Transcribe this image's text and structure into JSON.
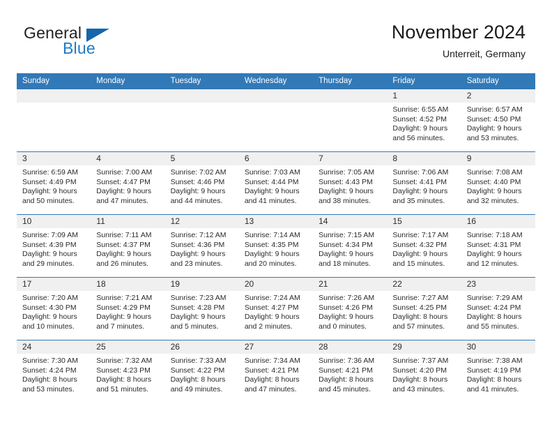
{
  "brand": {
    "word1": "General",
    "word2": "Blue",
    "triangle_color": "#1566ad",
    "blue_color": "#1f7ac4"
  },
  "header": {
    "title": "November 2024",
    "subtitle": "Unterreit, Germany",
    "accent_color": "#3279b7"
  },
  "weekday_headers": [
    "Sunday",
    "Monday",
    "Tuesday",
    "Wednesday",
    "Thursday",
    "Friday",
    "Saturday"
  ],
  "weeks": [
    [
      {
        "day": "",
        "sunrise": "",
        "sunset": "",
        "daylight_line1": "",
        "daylight_line2": ""
      },
      {
        "day": "",
        "sunrise": "",
        "sunset": "",
        "daylight_line1": "",
        "daylight_line2": ""
      },
      {
        "day": "",
        "sunrise": "",
        "sunset": "",
        "daylight_line1": "",
        "daylight_line2": ""
      },
      {
        "day": "",
        "sunrise": "",
        "sunset": "",
        "daylight_line1": "",
        "daylight_line2": ""
      },
      {
        "day": "",
        "sunrise": "",
        "sunset": "",
        "daylight_line1": "",
        "daylight_line2": ""
      },
      {
        "day": "1",
        "sunrise": "Sunrise: 6:55 AM",
        "sunset": "Sunset: 4:52 PM",
        "daylight_line1": "Daylight: 9 hours",
        "daylight_line2": "and 56 minutes."
      },
      {
        "day": "2",
        "sunrise": "Sunrise: 6:57 AM",
        "sunset": "Sunset: 4:50 PM",
        "daylight_line1": "Daylight: 9 hours",
        "daylight_line2": "and 53 minutes."
      }
    ],
    [
      {
        "day": "3",
        "sunrise": "Sunrise: 6:59 AM",
        "sunset": "Sunset: 4:49 PM",
        "daylight_line1": "Daylight: 9 hours",
        "daylight_line2": "and 50 minutes."
      },
      {
        "day": "4",
        "sunrise": "Sunrise: 7:00 AM",
        "sunset": "Sunset: 4:47 PM",
        "daylight_line1": "Daylight: 9 hours",
        "daylight_line2": "and 47 minutes."
      },
      {
        "day": "5",
        "sunrise": "Sunrise: 7:02 AM",
        "sunset": "Sunset: 4:46 PM",
        "daylight_line1": "Daylight: 9 hours",
        "daylight_line2": "and 44 minutes."
      },
      {
        "day": "6",
        "sunrise": "Sunrise: 7:03 AM",
        "sunset": "Sunset: 4:44 PM",
        "daylight_line1": "Daylight: 9 hours",
        "daylight_line2": "and 41 minutes."
      },
      {
        "day": "7",
        "sunrise": "Sunrise: 7:05 AM",
        "sunset": "Sunset: 4:43 PM",
        "daylight_line1": "Daylight: 9 hours",
        "daylight_line2": "and 38 minutes."
      },
      {
        "day": "8",
        "sunrise": "Sunrise: 7:06 AM",
        "sunset": "Sunset: 4:41 PM",
        "daylight_line1": "Daylight: 9 hours",
        "daylight_line2": "and 35 minutes."
      },
      {
        "day": "9",
        "sunrise": "Sunrise: 7:08 AM",
        "sunset": "Sunset: 4:40 PM",
        "daylight_line1": "Daylight: 9 hours",
        "daylight_line2": "and 32 minutes."
      }
    ],
    [
      {
        "day": "10",
        "sunrise": "Sunrise: 7:09 AM",
        "sunset": "Sunset: 4:39 PM",
        "daylight_line1": "Daylight: 9 hours",
        "daylight_line2": "and 29 minutes."
      },
      {
        "day": "11",
        "sunrise": "Sunrise: 7:11 AM",
        "sunset": "Sunset: 4:37 PM",
        "daylight_line1": "Daylight: 9 hours",
        "daylight_line2": "and 26 minutes."
      },
      {
        "day": "12",
        "sunrise": "Sunrise: 7:12 AM",
        "sunset": "Sunset: 4:36 PM",
        "daylight_line1": "Daylight: 9 hours",
        "daylight_line2": "and 23 minutes."
      },
      {
        "day": "13",
        "sunrise": "Sunrise: 7:14 AM",
        "sunset": "Sunset: 4:35 PM",
        "daylight_line1": "Daylight: 9 hours",
        "daylight_line2": "and 20 minutes."
      },
      {
        "day": "14",
        "sunrise": "Sunrise: 7:15 AM",
        "sunset": "Sunset: 4:34 PM",
        "daylight_line1": "Daylight: 9 hours",
        "daylight_line2": "and 18 minutes."
      },
      {
        "day": "15",
        "sunrise": "Sunrise: 7:17 AM",
        "sunset": "Sunset: 4:32 PM",
        "daylight_line1": "Daylight: 9 hours",
        "daylight_line2": "and 15 minutes."
      },
      {
        "day": "16",
        "sunrise": "Sunrise: 7:18 AM",
        "sunset": "Sunset: 4:31 PM",
        "daylight_line1": "Daylight: 9 hours",
        "daylight_line2": "and 12 minutes."
      }
    ],
    [
      {
        "day": "17",
        "sunrise": "Sunrise: 7:20 AM",
        "sunset": "Sunset: 4:30 PM",
        "daylight_line1": "Daylight: 9 hours",
        "daylight_line2": "and 10 minutes."
      },
      {
        "day": "18",
        "sunrise": "Sunrise: 7:21 AM",
        "sunset": "Sunset: 4:29 PM",
        "daylight_line1": "Daylight: 9 hours",
        "daylight_line2": "and 7 minutes."
      },
      {
        "day": "19",
        "sunrise": "Sunrise: 7:23 AM",
        "sunset": "Sunset: 4:28 PM",
        "daylight_line1": "Daylight: 9 hours",
        "daylight_line2": "and 5 minutes."
      },
      {
        "day": "20",
        "sunrise": "Sunrise: 7:24 AM",
        "sunset": "Sunset: 4:27 PM",
        "daylight_line1": "Daylight: 9 hours",
        "daylight_line2": "and 2 minutes."
      },
      {
        "day": "21",
        "sunrise": "Sunrise: 7:26 AM",
        "sunset": "Sunset: 4:26 PM",
        "daylight_line1": "Daylight: 9 hours",
        "daylight_line2": "and 0 minutes."
      },
      {
        "day": "22",
        "sunrise": "Sunrise: 7:27 AM",
        "sunset": "Sunset: 4:25 PM",
        "daylight_line1": "Daylight: 8 hours",
        "daylight_line2": "and 57 minutes."
      },
      {
        "day": "23",
        "sunrise": "Sunrise: 7:29 AM",
        "sunset": "Sunset: 4:24 PM",
        "daylight_line1": "Daylight: 8 hours",
        "daylight_line2": "and 55 minutes."
      }
    ],
    [
      {
        "day": "24",
        "sunrise": "Sunrise: 7:30 AM",
        "sunset": "Sunset: 4:24 PM",
        "daylight_line1": "Daylight: 8 hours",
        "daylight_line2": "and 53 minutes."
      },
      {
        "day": "25",
        "sunrise": "Sunrise: 7:32 AM",
        "sunset": "Sunset: 4:23 PM",
        "daylight_line1": "Daylight: 8 hours",
        "daylight_line2": "and 51 minutes."
      },
      {
        "day": "26",
        "sunrise": "Sunrise: 7:33 AM",
        "sunset": "Sunset: 4:22 PM",
        "daylight_line1": "Daylight: 8 hours",
        "daylight_line2": "and 49 minutes."
      },
      {
        "day": "27",
        "sunrise": "Sunrise: 7:34 AM",
        "sunset": "Sunset: 4:21 PM",
        "daylight_line1": "Daylight: 8 hours",
        "daylight_line2": "and 47 minutes."
      },
      {
        "day": "28",
        "sunrise": "Sunrise: 7:36 AM",
        "sunset": "Sunset: 4:21 PM",
        "daylight_line1": "Daylight: 8 hours",
        "daylight_line2": "and 45 minutes."
      },
      {
        "day": "29",
        "sunrise": "Sunrise: 7:37 AM",
        "sunset": "Sunset: 4:20 PM",
        "daylight_line1": "Daylight: 8 hours",
        "daylight_line2": "and 43 minutes."
      },
      {
        "day": "30",
        "sunrise": "Sunrise: 7:38 AM",
        "sunset": "Sunset: 4:19 PM",
        "daylight_line1": "Daylight: 8 hours",
        "daylight_line2": "and 41 minutes."
      }
    ]
  ]
}
